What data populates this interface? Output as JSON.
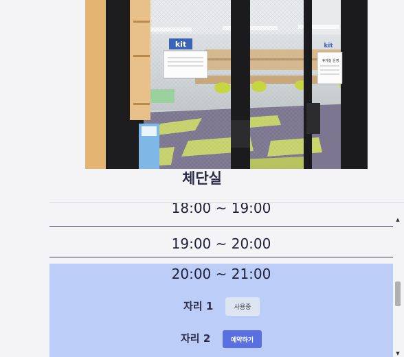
{
  "room": {
    "title": "체단실"
  },
  "photo": {
    "sign_logo": "kit",
    "sign_logo_right": "kit",
    "door_notice_title": "휴게실 운영"
  },
  "timeslots": [
    {
      "label": "18:00 ~ 19:00"
    },
    {
      "label": "19:00 ~ 20:00"
    },
    {
      "label": "20:00 ~ 21:00"
    }
  ],
  "seats": [
    {
      "label": "자리 1",
      "button": "사용중"
    },
    {
      "label": "자리 2",
      "button": "예약하기"
    }
  ],
  "colors": {
    "selected_bg": "#bccdf7",
    "reserve_button": "#5a6fe0",
    "inuse_button": "#dde4f2"
  }
}
